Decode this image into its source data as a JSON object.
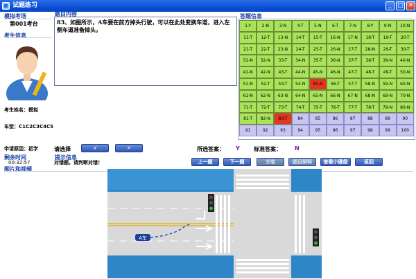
{
  "window": {
    "title": "试题练习",
    "buttons": [
      "_",
      "□",
      "✕"
    ]
  },
  "left": {
    "venue_title": "模拟考场",
    "seat": "第001考台",
    "candidate_title": "考生信息",
    "name": "考生姓名：模拟",
    "vehicle": "车型：C1C2C3C4C5",
    "reason": "申请原因：初学",
    "remaining_title": "剩余时间",
    "remaining_time": "00:32:57",
    "media_title": "图片和视频"
  },
  "question": {
    "title": "题目内容",
    "text": "83、如图所示，A车要在前方掉头行驶，可以在此处变换车道，进入左侧车道准备掉头。"
  },
  "answer_panel": {
    "title": "答题信息",
    "cells": [
      {
        "label": "1-Y",
        "state": "correct"
      },
      {
        "label": "2-N",
        "state": "correct"
      },
      {
        "label": "3-N",
        "state": "correct"
      },
      {
        "label": "4-T",
        "state": "correct"
      },
      {
        "label": "5-N",
        "state": "correct"
      },
      {
        "label": "6-T",
        "state": "correct"
      },
      {
        "label": "7-N",
        "state": "correct"
      },
      {
        "label": "8-Y",
        "state": "correct"
      },
      {
        "label": "9-N",
        "state": "correct"
      },
      {
        "label": "10-N",
        "state": "correct"
      },
      {
        "label": "11-T",
        "state": "correct"
      },
      {
        "label": "12-T",
        "state": "correct"
      },
      {
        "label": "13-N",
        "state": "correct"
      },
      {
        "label": "14-T",
        "state": "correct"
      },
      {
        "label": "15-T",
        "state": "correct"
      },
      {
        "label": "16-N",
        "state": "correct"
      },
      {
        "label": "17-N",
        "state": "correct"
      },
      {
        "label": "18-T",
        "state": "correct"
      },
      {
        "label": "19-T",
        "state": "correct"
      },
      {
        "label": "20-T",
        "state": "correct"
      },
      {
        "label": "21-T",
        "state": "correct"
      },
      {
        "label": "22-T",
        "state": "correct"
      },
      {
        "label": "23-N",
        "state": "correct"
      },
      {
        "label": "24-T",
        "state": "correct"
      },
      {
        "label": "25-T",
        "state": "correct"
      },
      {
        "label": "26-N",
        "state": "correct"
      },
      {
        "label": "27-T",
        "state": "correct"
      },
      {
        "label": "28-N",
        "state": "correct"
      },
      {
        "label": "29-T",
        "state": "correct"
      },
      {
        "label": "30-T",
        "state": "correct"
      },
      {
        "label": "31-N",
        "state": "correct"
      },
      {
        "label": "32-N",
        "state": "correct"
      },
      {
        "label": "33-T",
        "state": "correct"
      },
      {
        "label": "34-N",
        "state": "correct"
      },
      {
        "label": "35-T",
        "state": "correct"
      },
      {
        "label": "36-N",
        "state": "correct"
      },
      {
        "label": "37-T",
        "state": "correct"
      },
      {
        "label": "38-T",
        "state": "correct"
      },
      {
        "label": "39-N",
        "state": "correct"
      },
      {
        "label": "40-N",
        "state": "correct"
      },
      {
        "label": "41-N",
        "state": "correct"
      },
      {
        "label": "42-N",
        "state": "correct"
      },
      {
        "label": "43-T",
        "state": "correct"
      },
      {
        "label": "44-N",
        "state": "correct"
      },
      {
        "label": "45-N",
        "state": "correct"
      },
      {
        "label": "46-N",
        "state": "correct"
      },
      {
        "label": "47-T",
        "state": "correct"
      },
      {
        "label": "48-T",
        "state": "correct"
      },
      {
        "label": "49-T",
        "state": "correct"
      },
      {
        "label": "50-N",
        "state": "correct"
      },
      {
        "label": "51-N",
        "state": "correct"
      },
      {
        "label": "52-T",
        "state": "correct"
      },
      {
        "label": "53-T",
        "state": "correct"
      },
      {
        "label": "54-N",
        "state": "correct"
      },
      {
        "label": "55-N",
        "state": "wrong"
      },
      {
        "label": "56-T",
        "state": "correct"
      },
      {
        "label": "57-T",
        "state": "correct"
      },
      {
        "label": "58-N",
        "state": "correct"
      },
      {
        "label": "59-N",
        "state": "correct"
      },
      {
        "label": "60-N",
        "state": "correct"
      },
      {
        "label": "61-N",
        "state": "correct"
      },
      {
        "label": "62-N",
        "state": "correct"
      },
      {
        "label": "63-N",
        "state": "correct"
      },
      {
        "label": "64-N",
        "state": "correct"
      },
      {
        "label": "65-N",
        "state": "correct"
      },
      {
        "label": "66-N",
        "state": "correct"
      },
      {
        "label": "67-N",
        "state": "correct"
      },
      {
        "label": "68-N",
        "state": "correct"
      },
      {
        "label": "69-N",
        "state": "correct"
      },
      {
        "label": "70-N",
        "state": "correct"
      },
      {
        "label": "71-T",
        "state": "correct"
      },
      {
        "label": "72-T",
        "state": "correct"
      },
      {
        "label": "73-T",
        "state": "correct"
      },
      {
        "label": "74-T",
        "state": "correct"
      },
      {
        "label": "75-T",
        "state": "correct"
      },
      {
        "label": "76-T",
        "state": "correct"
      },
      {
        "label": "77-T",
        "state": "correct"
      },
      {
        "label": "78-T",
        "state": "correct"
      },
      {
        "label": "79-N",
        "state": "correct"
      },
      {
        "label": "80-N",
        "state": "correct"
      },
      {
        "label": "81-T",
        "state": "correct"
      },
      {
        "label": "82-N",
        "state": "correct"
      },
      {
        "label": "83-T",
        "state": "wrong"
      },
      {
        "label": "84",
        "state": "unanswered"
      },
      {
        "label": "85",
        "state": "unanswered"
      },
      {
        "label": "86",
        "state": "unanswered"
      },
      {
        "label": "87",
        "state": "unanswered"
      },
      {
        "label": "88",
        "state": "unanswered"
      },
      {
        "label": "89",
        "state": "unanswered"
      },
      {
        "label": "90",
        "state": "unanswered"
      },
      {
        "label": "91",
        "state": "unanswered"
      },
      {
        "label": "92",
        "state": "unanswered"
      },
      {
        "label": "93",
        "state": "unanswered"
      },
      {
        "label": "94",
        "state": "unanswered"
      },
      {
        "label": "95",
        "state": "unanswered"
      },
      {
        "label": "96",
        "state": "unanswered"
      },
      {
        "label": "97",
        "state": "unanswered"
      },
      {
        "label": "98",
        "state": "unanswered"
      },
      {
        "label": "99",
        "state": "unanswered"
      },
      {
        "label": "100",
        "state": "unanswered"
      }
    ],
    "colors": {
      "correct": "#a9e35a",
      "wrong": "#e53521",
      "unanswered": "#c7c6f2"
    }
  },
  "choose": {
    "label": "请选择",
    "options": [
      "√",
      "✕"
    ]
  },
  "answers": {
    "selected_label": "所选答案：",
    "selected_value": "Y",
    "standard_label": "标准答案：",
    "standard_value": "N"
  },
  "hint": {
    "title": "提示信息",
    "text": "对错题，请判断对错！"
  },
  "actions": {
    "prev": "上一题",
    "next": "下一题",
    "submit": "交卷",
    "explain": "题目解释",
    "view_keyboard": "查看小键盘",
    "back": "返回"
  },
  "scene": {
    "car_label": "A车"
  }
}
